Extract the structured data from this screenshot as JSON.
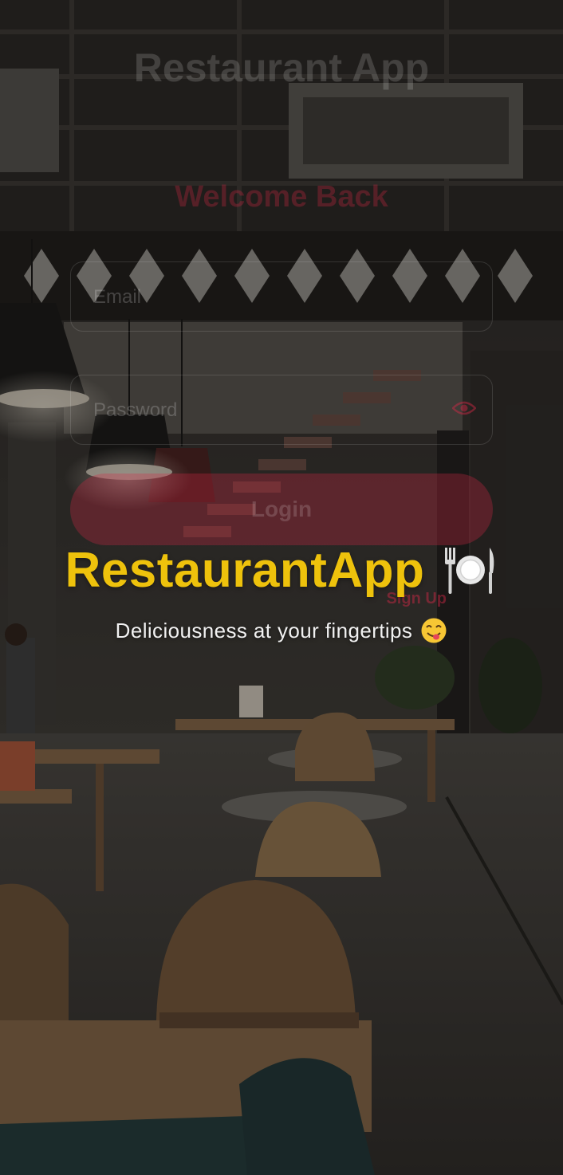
{
  "app": {
    "brand_name": "RestaurantApp",
    "brand_icon": "fork-plate-knife-icon",
    "tagline": "Deliciousness at your fingertips",
    "tagline_icon": "yum-face-emoji-icon"
  },
  "login_form": {
    "title": "Restaurant App",
    "subtitle": "Welcome Back",
    "email_placeholder": "Email",
    "password_placeholder": "Password",
    "password_toggle_icon": "eye-icon",
    "login_button": "Login",
    "signup_link": "Sign Up"
  },
  "colors": {
    "brand_yellow": "#eec20c",
    "accent_red": "#d72846",
    "tagline_white": "#f1f1f1"
  }
}
